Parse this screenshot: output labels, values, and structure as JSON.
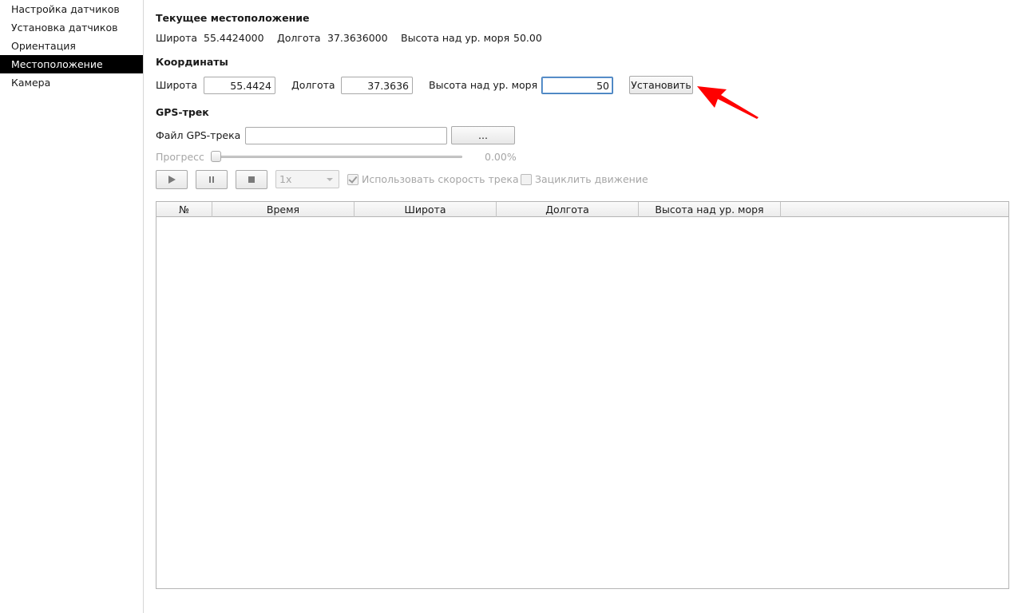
{
  "sidebar": {
    "items": [
      {
        "label": "Настройка датчиков"
      },
      {
        "label": "Установка датчиков"
      },
      {
        "label": "Ориентация"
      },
      {
        "label": "Местоположение"
      },
      {
        "label": "Камера"
      }
    ],
    "active_index": 3
  },
  "current_location": {
    "title": "Текущее местоположение",
    "latitude_label": "Широта",
    "latitude_value": "55.4424000",
    "longitude_label": "Долгота",
    "longitude_value": "37.3636000",
    "altitude_label": "Высота над ур. моря",
    "altitude_value": "50.00"
  },
  "coordinates": {
    "title": "Координаты",
    "latitude_label": "Широта",
    "latitude_value": "55.4424",
    "longitude_label": "Долгота",
    "longitude_value": "37.3636",
    "altitude_label": "Высота над ур. моря",
    "altitude_value": "50",
    "set_button": "Установить"
  },
  "gps_track": {
    "title": "GPS-трек",
    "file_label": "Файл GPS-трека",
    "file_value": "",
    "browse_button": "...",
    "progress_label": "Прогресс",
    "progress_value": "0.00%",
    "progress_fraction": 0.0,
    "speed_value": "1x",
    "use_track_speed_label": "Использовать скорость трека",
    "use_track_speed_checked": true,
    "loop_label": "Зациклить движение",
    "loop_checked": false
  },
  "table": {
    "columns": [
      "№",
      "Время",
      "Широта",
      "Долгота",
      "Высота над ур. моря"
    ],
    "rows": []
  },
  "colors": {
    "accent": "#ff0000",
    "sidebar_active_bg": "#000000",
    "focus_border": "#3a78b8"
  }
}
